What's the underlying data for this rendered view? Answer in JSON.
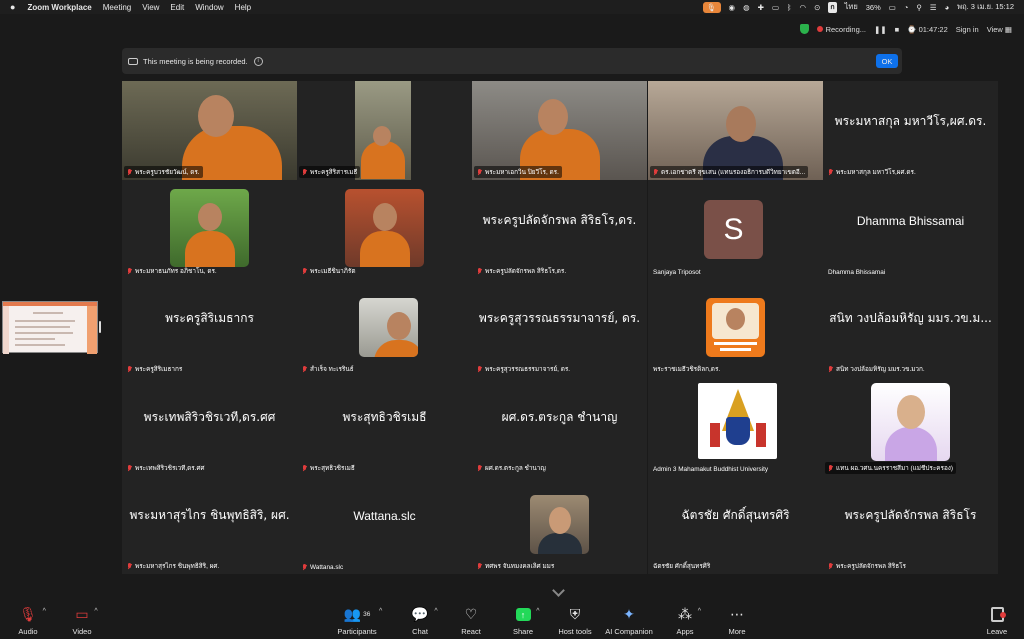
{
  "menubar": {
    "app": "Zoom Workplace",
    "items": [
      "Meeting",
      "View",
      "Edit",
      "Window",
      "Help"
    ],
    "battery": "36%",
    "lang": "ไทย",
    "clock": "พฤ. 3 เม.ย.  15:12",
    "kb_badge": "ก"
  },
  "topbar": {
    "recording": "Recording...",
    "timer": "01:47:22",
    "signin": "Sign in",
    "view": "View"
  },
  "banner": {
    "text": "This meeting is being recorded.",
    "ok": "OK"
  },
  "tiles": [
    {
      "label": "พระครูบวรชัยวัฒน์, ดร.",
      "kind": "video"
    },
    {
      "label": "พระครูสิริสารเมธี",
      "kind": "video-small"
    },
    {
      "label": "พระมหาเอกวิน ปิยวีโร, ดร.",
      "kind": "video"
    },
    {
      "label": "ดร.เอกชาตรี สุขเสน (แทนรองอธิการบดีวิทยาเขตอี...",
      "kind": "video"
    },
    {
      "label": "พระมหาสกุล มหาวีโร,ผศ.ดร.",
      "display": "พระมหาสกุล มหาวีโร,ผศ.ดร.",
      "kind": "name"
    },
    {
      "label": "พระมหาธนภัทร อภิชาโน, ดร.",
      "kind": "photo"
    },
    {
      "label": "พระเมธีชินาภิรัต",
      "kind": "photo"
    },
    {
      "label": "พระครูปลัดจักรพล สิริธโร,ดร.",
      "display": "พระครูปลัดจักรพล สิริธโร,ดร.",
      "kind": "name"
    },
    {
      "label": "Sanjaya Triposot",
      "avatar": "S",
      "kind": "avatar"
    },
    {
      "label": "Dhamma Bhissamai",
      "display": "Dhamma Bhissamai",
      "kind": "name"
    },
    {
      "label": "พระครูสิริเมธากร",
      "display": "พระครูสิริเมธากร",
      "kind": "name"
    },
    {
      "label": "สำเร็จ ทะเรรินธ์",
      "kind": "photo"
    },
    {
      "label": "พระครูสุวรรณธรรมาจารย์, ดร.",
      "display": "พระครูสุวรรณธรรมาจารย์, ดร.",
      "kind": "name"
    },
    {
      "label": "พระราชเมธีวชิรดิลก,ดร.",
      "kind": "logo-orange"
    },
    {
      "label": "สนิท วงปล้อมหิรัญ มมร.วข.มวก.",
      "display": "สนิท วงปล้อมหิรัญ มมร.วข.ม...",
      "kind": "name"
    },
    {
      "label": "พระเทพสิริวชิรเวที,ดร.ศศ",
      "display": "พระเทพสิริวชิรเวที,ดร.ศศ",
      "kind": "name"
    },
    {
      "label": "พระสุทธิวชิรเมธี",
      "display": "พระสุทธิวชิรเมธี",
      "kind": "name"
    },
    {
      "label": "ผศ.ดร.ตระกูล ชำนาญ",
      "display": "ผศ.ดร.ตระกูล ชำนาญ",
      "kind": "name"
    },
    {
      "label": "Admin 3 Mahamakut Buddhist University",
      "kind": "emblem"
    },
    {
      "label": "แทน ผอ.วศน.นครราชสีมา (แม่ชีประครอง)",
      "kind": "photo-nun"
    },
    {
      "label": "พระมหาสุรไกร ชินพุทธิสิริ, ผศ.",
      "display": "พระมหาสุรไกร ชินพุทธิสิริ, ผศ.",
      "kind": "name"
    },
    {
      "label": "Wattana.slc",
      "display": "Wattana.slc",
      "kind": "name"
    },
    {
      "label": "ทศพร จันทมงคลเลิศ มมร",
      "kind": "photo-man"
    },
    {
      "label": "ฉัตรชัย ศักดิ์สุนทรศิริ",
      "display": "ฉัตรชัย ศักดิ์สุนทรศิริ",
      "kind": "name-unmuted"
    },
    {
      "label": "พระครูปลัดจักรพล สิริธโร",
      "display": "พระครูปลัดจักรพล สิริธโร",
      "kind": "name"
    }
  ],
  "toolbar": {
    "audio": "Audio",
    "video": "Video",
    "participants": "Participants",
    "participants_count": "36",
    "chat": "Chat",
    "react": "React",
    "share": "Share",
    "host_tools": "Host tools",
    "ai": "AI Companion",
    "apps": "Apps",
    "more": "More",
    "leave": "Leave"
  },
  "colors": {
    "active_speaker": "#23d959",
    "ok_button": "#0e71eb",
    "share_button": "#23d959",
    "mute_red": "#e03c3c"
  }
}
